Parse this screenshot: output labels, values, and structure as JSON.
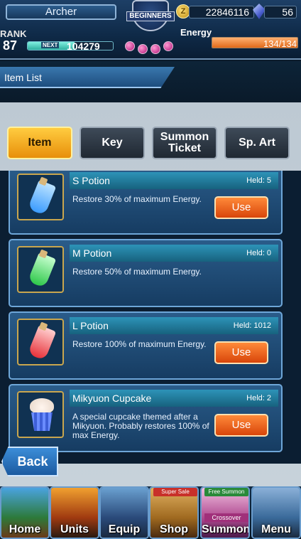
{
  "player": {
    "name": "Archer",
    "rank_label": "RANK",
    "rank": "87",
    "next_label": "NEXT",
    "next_exp": "104279",
    "exp_progress": 0.55,
    "coins": "22846116",
    "crystals": "56",
    "energy_label": "Energy",
    "energy": "134/134",
    "energy_progress": 1.0
  },
  "emblem": {
    "text": "BEGINNERS"
  },
  "header": {
    "title": "Item List"
  },
  "tabs": [
    {
      "label": "Item",
      "active": true
    },
    {
      "label": "Key",
      "active": false
    },
    {
      "label": "Summon Ticket",
      "active": false
    },
    {
      "label": "Sp. Art",
      "active": false
    }
  ],
  "items": [
    {
      "name": "S Potion",
      "held": "Held: 5",
      "description": "Restore 30% of maximum Energy.",
      "use_label": "Use",
      "usable": true,
      "icon": "blue-potion-icon",
      "color": "#3a9bff"
    },
    {
      "name": "M Potion",
      "held": "Held: 0",
      "description": "Restore 50% of maximum Energy.",
      "use_label": "",
      "usable": false,
      "icon": "green-potion-icon",
      "color": "#2ec84a"
    },
    {
      "name": "L Potion",
      "held": "Held: 1012",
      "description": "Restore 100% of maximum Energy.",
      "use_label": "Use",
      "usable": true,
      "icon": "red-potion-icon",
      "color": "#e8323a"
    },
    {
      "name": "Mikyuon Cupcake",
      "held": "Held: 2",
      "description": "A special cupcake themed after a Mikyuon. Probably restores 100% of max Energy.",
      "use_label": "Use",
      "usable": true,
      "icon": "cupcake-icon",
      "color": "#5a7cff"
    }
  ],
  "back_label": "Back",
  "nav": [
    {
      "label": "Home",
      "icon": "home-icon",
      "ribbon": ""
    },
    {
      "label": "Units",
      "icon": "units-icon",
      "ribbon": ""
    },
    {
      "label": "Equip",
      "icon": "equip-icon",
      "ribbon": ""
    },
    {
      "label": "Shop",
      "icon": "shop-icon",
      "ribbon": "Super Sale"
    },
    {
      "label": "Summon",
      "icon": "summon-icon",
      "ribbon": "Free Summon",
      "sub": "Crossover"
    },
    {
      "label": "Menu",
      "icon": "menu-icon",
      "ribbon": ""
    }
  ]
}
